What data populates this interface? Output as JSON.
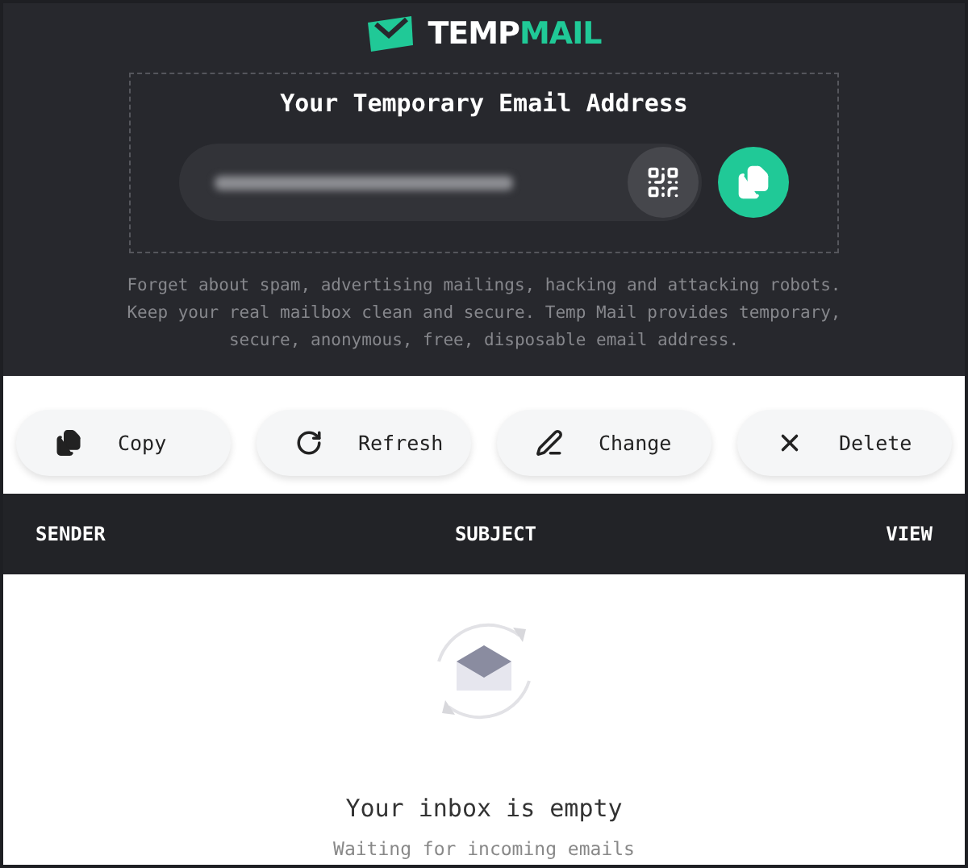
{
  "logo": {
    "first": "TEMP",
    "second": "MAIL"
  },
  "address_panel": {
    "title": "Your Temporary Email Address"
  },
  "description": "Forget about spam, advertising mailings, hacking and attacking robots. Keep your real mailbox clean and secure. Temp Mail provides temporary, secure, anonymous, free, disposable email address.",
  "actions": [
    {
      "kind": "copy",
      "label": "Copy"
    },
    {
      "kind": "refresh",
      "label": "Refresh"
    },
    {
      "kind": "change",
      "label": "Change"
    },
    {
      "kind": "delete",
      "label": "Delete"
    }
  ],
  "table": {
    "columns": [
      "SENDER",
      "SUBJECT",
      "VIEW"
    ]
  },
  "empty_state": {
    "title": "Your inbox is empty",
    "subtitle": "Waiting for incoming emails"
  }
}
